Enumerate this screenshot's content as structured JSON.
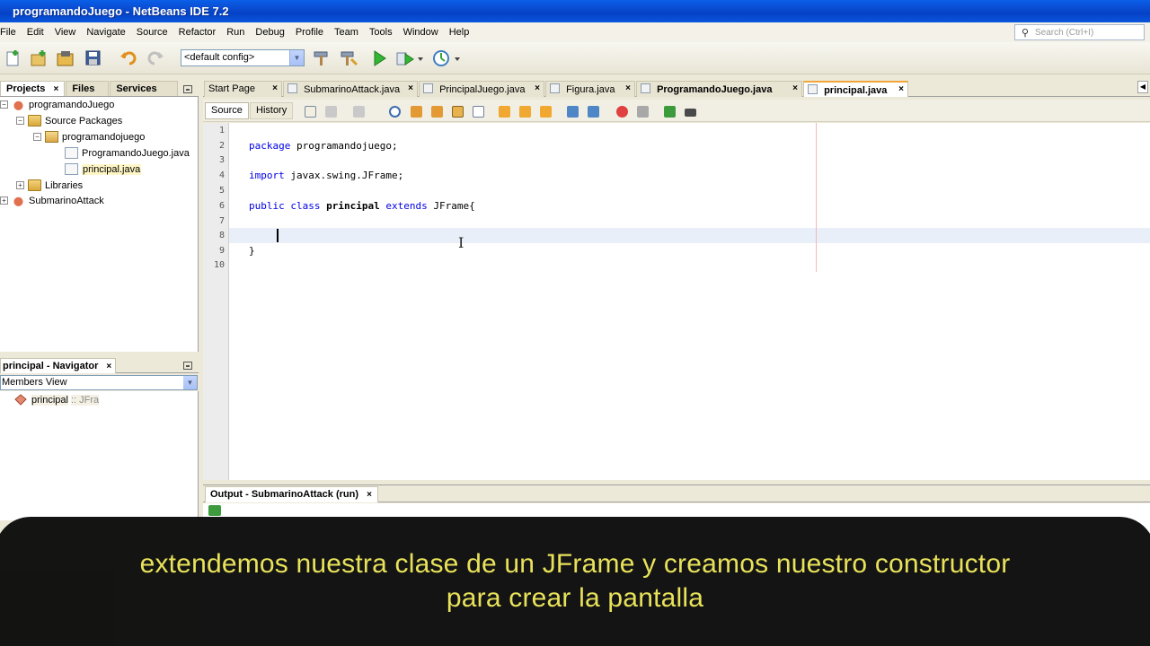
{
  "window": {
    "title": "programandoJuego - NetBeans IDE 7.2"
  },
  "menu": [
    "File",
    "Edit",
    "View",
    "Navigate",
    "Source",
    "Refactor",
    "Run",
    "Debug",
    "Profile",
    "Team",
    "Tools",
    "Window",
    "Help"
  ],
  "search": {
    "placeholder": "Search (Ctrl+I)"
  },
  "toolbar": {
    "config": "<default config>"
  },
  "left_tabs": {
    "projects": "Projects",
    "files": "Files",
    "services": "Services",
    "close": "×"
  },
  "tree": {
    "project": "programandoJuego",
    "source_packages": "Source Packages",
    "package": "programandojuego",
    "file1": "ProgramandoJuego.java",
    "file2": "principal.java",
    "libraries": "Libraries",
    "project2": "SubmarinoAttack"
  },
  "navigator": {
    "title": "principal - Navigator",
    "close": "×",
    "view": "Members View",
    "node": "principal",
    "node_type": ":: JFra"
  },
  "editor_tabs": [
    {
      "label": "Start Page"
    },
    {
      "label": "SubmarinoAttack.java"
    },
    {
      "label": "PrincipalJuego.java"
    },
    {
      "label": "Figura.java"
    },
    {
      "label": "ProgramandoJuego.java"
    },
    {
      "label": "principal.java"
    }
  ],
  "tab_close": "×",
  "source_toolbar": {
    "source": "Source",
    "history": "History"
  },
  "code": {
    "line_numbers": [
      "1",
      "2",
      "3",
      "4",
      "5",
      "6",
      "7",
      "8",
      "9",
      "10"
    ],
    "l2_kw": "package",
    "l2_rest": " programandojuego;",
    "l4_kw": "import",
    "l4_rest": " javax.swing.JFrame;",
    "l6_kw1": "public",
    "l6_kw2": "class",
    "l6_name": "principal",
    "l6_kw3": "extends",
    "l6_rest": " JFrame{",
    "l9": "}"
  },
  "output": {
    "title": "Output - SubmarinoAttack (run)",
    "close": "×"
  },
  "subtitle": {
    "line1": "extendemos nuestra clase de un JFrame y creamos nuestro constructor",
    "line2": "para crear la pantalla"
  }
}
